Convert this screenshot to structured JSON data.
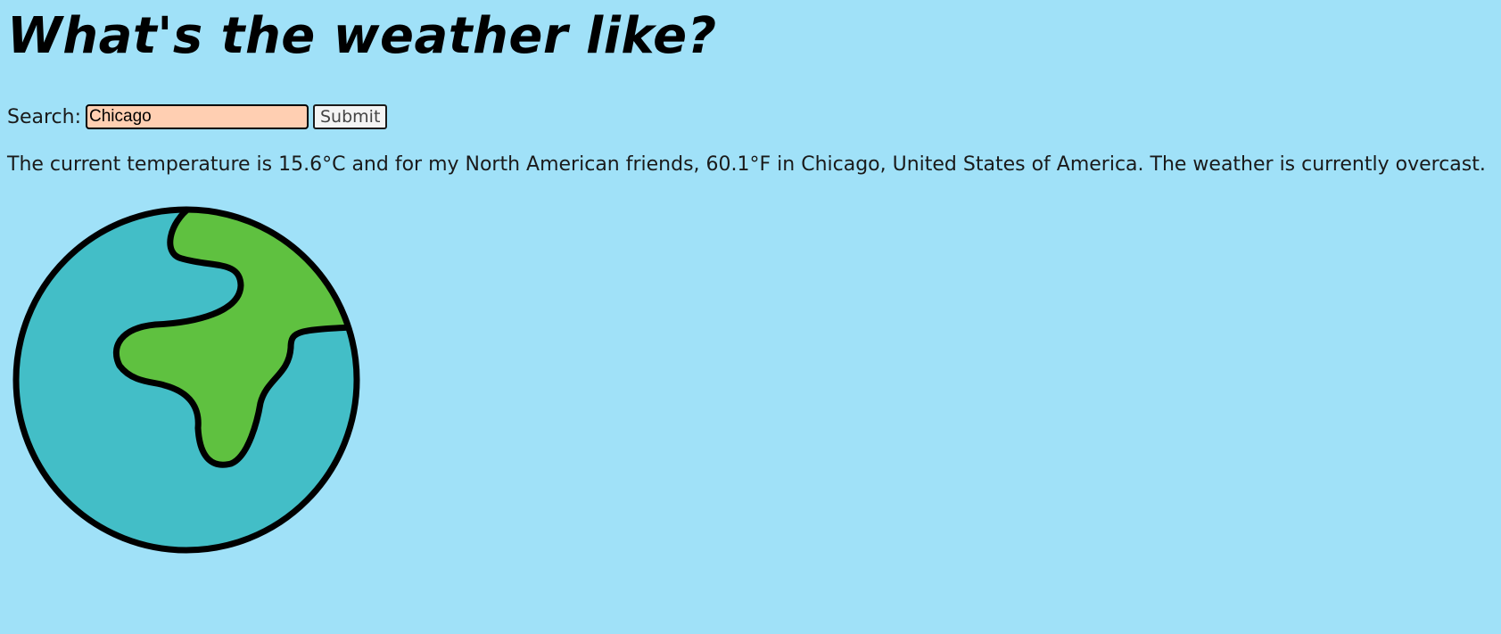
{
  "page": {
    "title": "What's the weather like?"
  },
  "search": {
    "label": "Search:",
    "value": "Chicago",
    "submit_label": "Submit"
  },
  "result": {
    "text": "The current temperature is 15.6°C and for my North American friends, 60.1°F in Chicago, United States of America. The weather is currently overcast."
  },
  "image": {
    "icon": "earth-globe-icon",
    "colors": {
      "ocean": "#43bec7",
      "land": "#5fc140",
      "outline": "#000000"
    }
  },
  "colors": {
    "background": "#a0e1f8",
    "input_background": "#ffcfb2"
  }
}
